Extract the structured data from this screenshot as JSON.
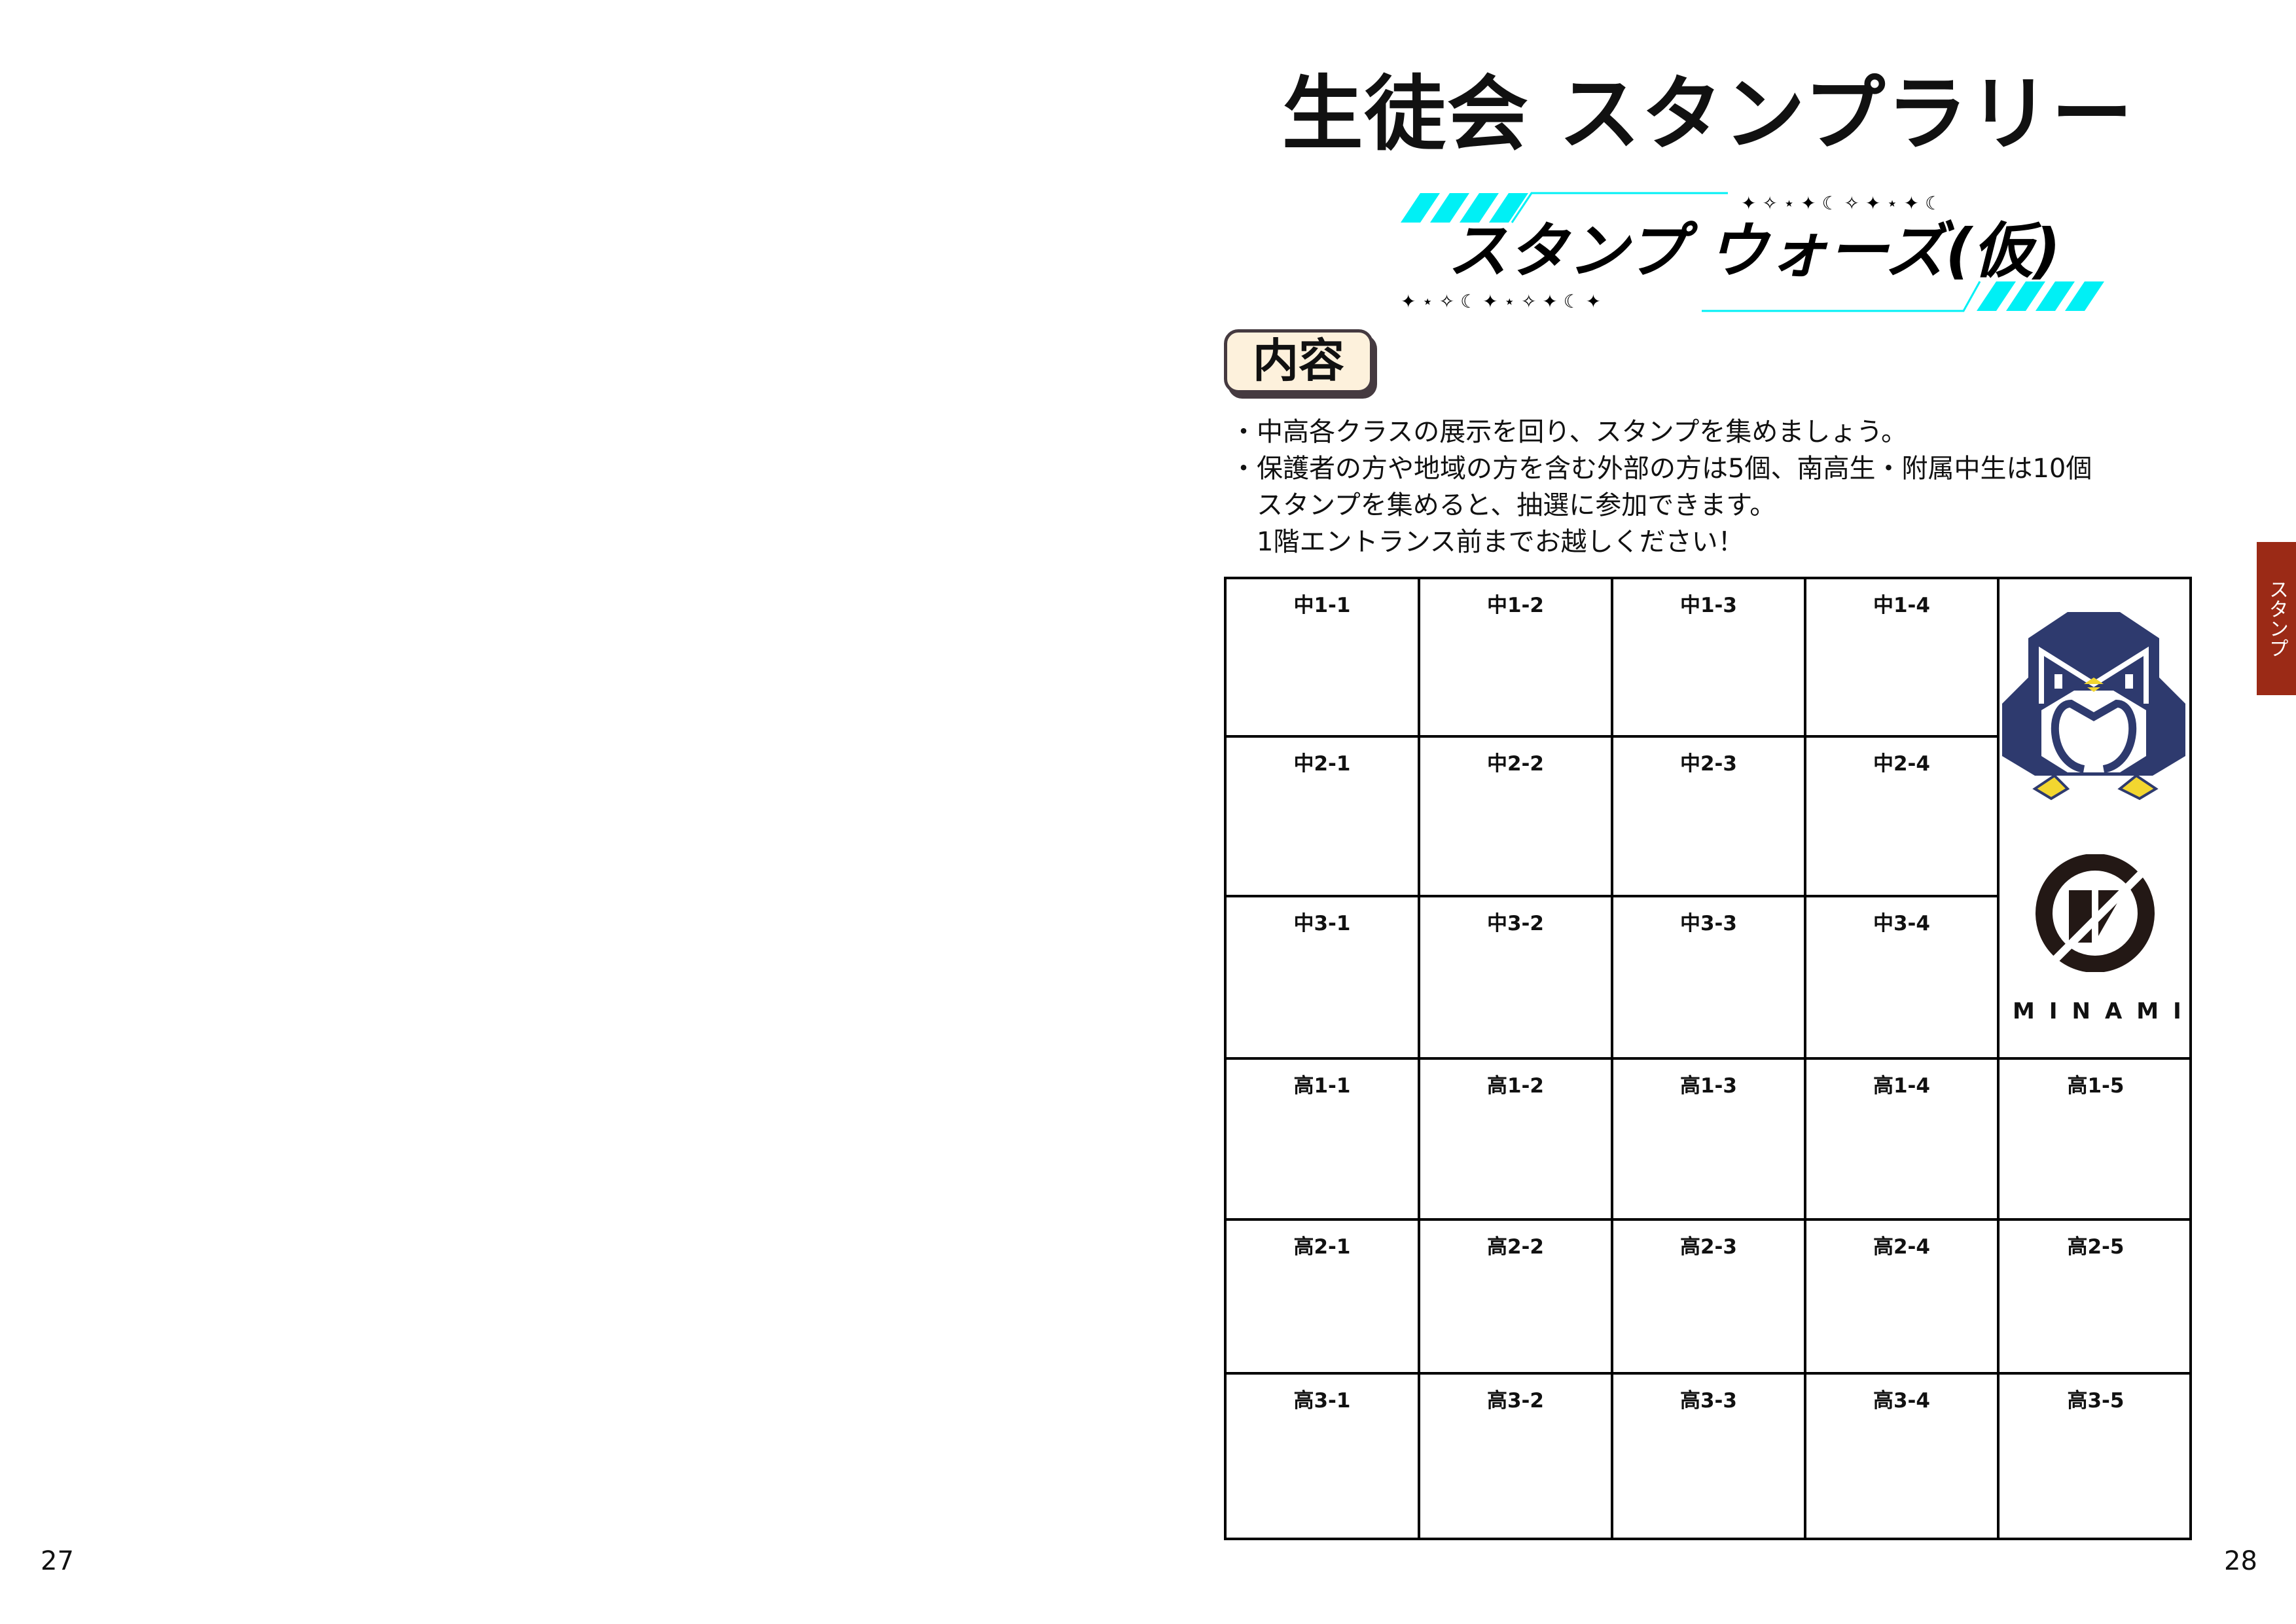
{
  "page_title": "生徒会 スタンプラリー",
  "banner": {
    "text": "スタンプ ウォーズ(仮)",
    "accent_color": "#00f0f5"
  },
  "section_badge": "内容",
  "description_lines": [
    "・中高各クラスの展示を回り、スタンプを集めましょう。",
    "・保護者の方や地域の方を含む外部の方は5個、南高生・附属中生は10個",
    "　スタンプを集めると、抽選に参加できます。",
    "　1階エントランス前までお越しください！"
  ],
  "stamp_cells": [
    [
      "中1-1",
      "中1-2",
      "中1-3",
      "中1-4"
    ],
    [
      "中2-1",
      "中2-2",
      "中2-3",
      "中2-4"
    ],
    [
      "中3-1",
      "中3-2",
      "中3-3",
      "中3-4"
    ],
    [
      "高1-1",
      "高1-2",
      "高1-3",
      "高1-4",
      "高1-5"
    ],
    [
      "高2-1",
      "高2-2",
      "高2-3",
      "高2-4",
      "高2-5"
    ],
    [
      "高3-1",
      "高3-2",
      "高3-3",
      "高3-4",
      "高3-5"
    ]
  ],
  "logo_text": "MINAMI",
  "side_tab": "スタンプ",
  "page_numbers": {
    "left": "27",
    "right": "28"
  },
  "colors": {
    "side_tab": "#9b2a16",
    "badge_bg": "#fdf1dc",
    "penguin": "#2e3a6e",
    "beak": "#f2d630"
  }
}
